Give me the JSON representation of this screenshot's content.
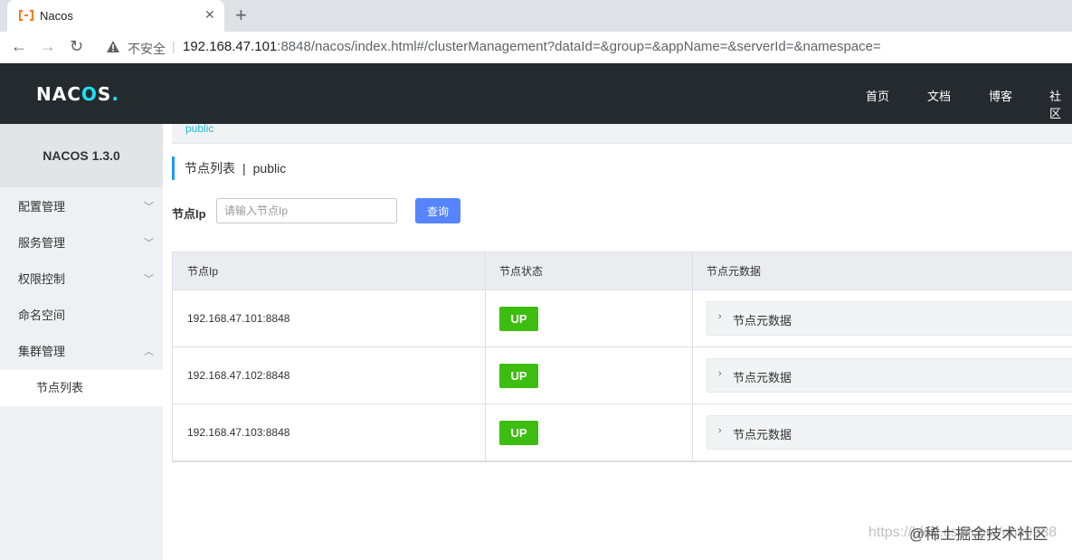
{
  "browser": {
    "tab_title": "Nacos",
    "close_glyph": "✕",
    "newtab_glyph": "+",
    "back_glyph": "←",
    "forward_glyph": "→",
    "reload_glyph": "↻",
    "security_text": "不安全",
    "separator": "|",
    "url_host": "192.168.47.101",
    "url_rest": ":8848/nacos/index.html#/clusterManagement?dataId=&group=&appName=&serverId=&namespace="
  },
  "header": {
    "logo_pre": "NAC",
    "logo_o": "O",
    "logo_post": "S",
    "logo_dot": ".",
    "nav": [
      "首页",
      "文档",
      "博客",
      "社区"
    ]
  },
  "sidebar": {
    "title": "NACOS 1.3.0",
    "items": [
      {
        "label": "配置管理",
        "chevron": "﹀"
      },
      {
        "label": "服务管理",
        "chevron": "﹀"
      },
      {
        "label": "权限控制",
        "chevron": "﹀"
      },
      {
        "label": "命名空间"
      },
      {
        "label": "集群管理",
        "chevron": "︿"
      }
    ],
    "sub_items": [
      {
        "label": "节点列表"
      }
    ]
  },
  "main": {
    "namespace_link": "public",
    "title": "节点列表",
    "title_sep": "|",
    "title_ns": "public",
    "filter_label": "节点Ip",
    "filter_placeholder": "请输入节点Ip",
    "query_label": "查询",
    "columns": [
      "节点Ip",
      "节点状态",
      "节点元数据"
    ],
    "rows": [
      {
        "ip": "192.168.47.101:8848",
        "status": "UP",
        "meta": "节点元数据"
      },
      {
        "ip": "192.168.47.102:8848",
        "status": "UP",
        "meta": "节点元数据"
      },
      {
        "ip": "192.168.47.103:8848",
        "status": "UP",
        "meta": "节点元数据"
      }
    ],
    "meta_chevron": "›"
  },
  "watermark": {
    "faint": "https://blog.csdn.net/chs0938",
    "at": "@稀土掘金技术社区"
  },
  "colors": {
    "header_bg": "#252a2f",
    "accent": "#1be1f6",
    "primary_btn": "#5584ff",
    "status_up": "#3dbd0f"
  }
}
